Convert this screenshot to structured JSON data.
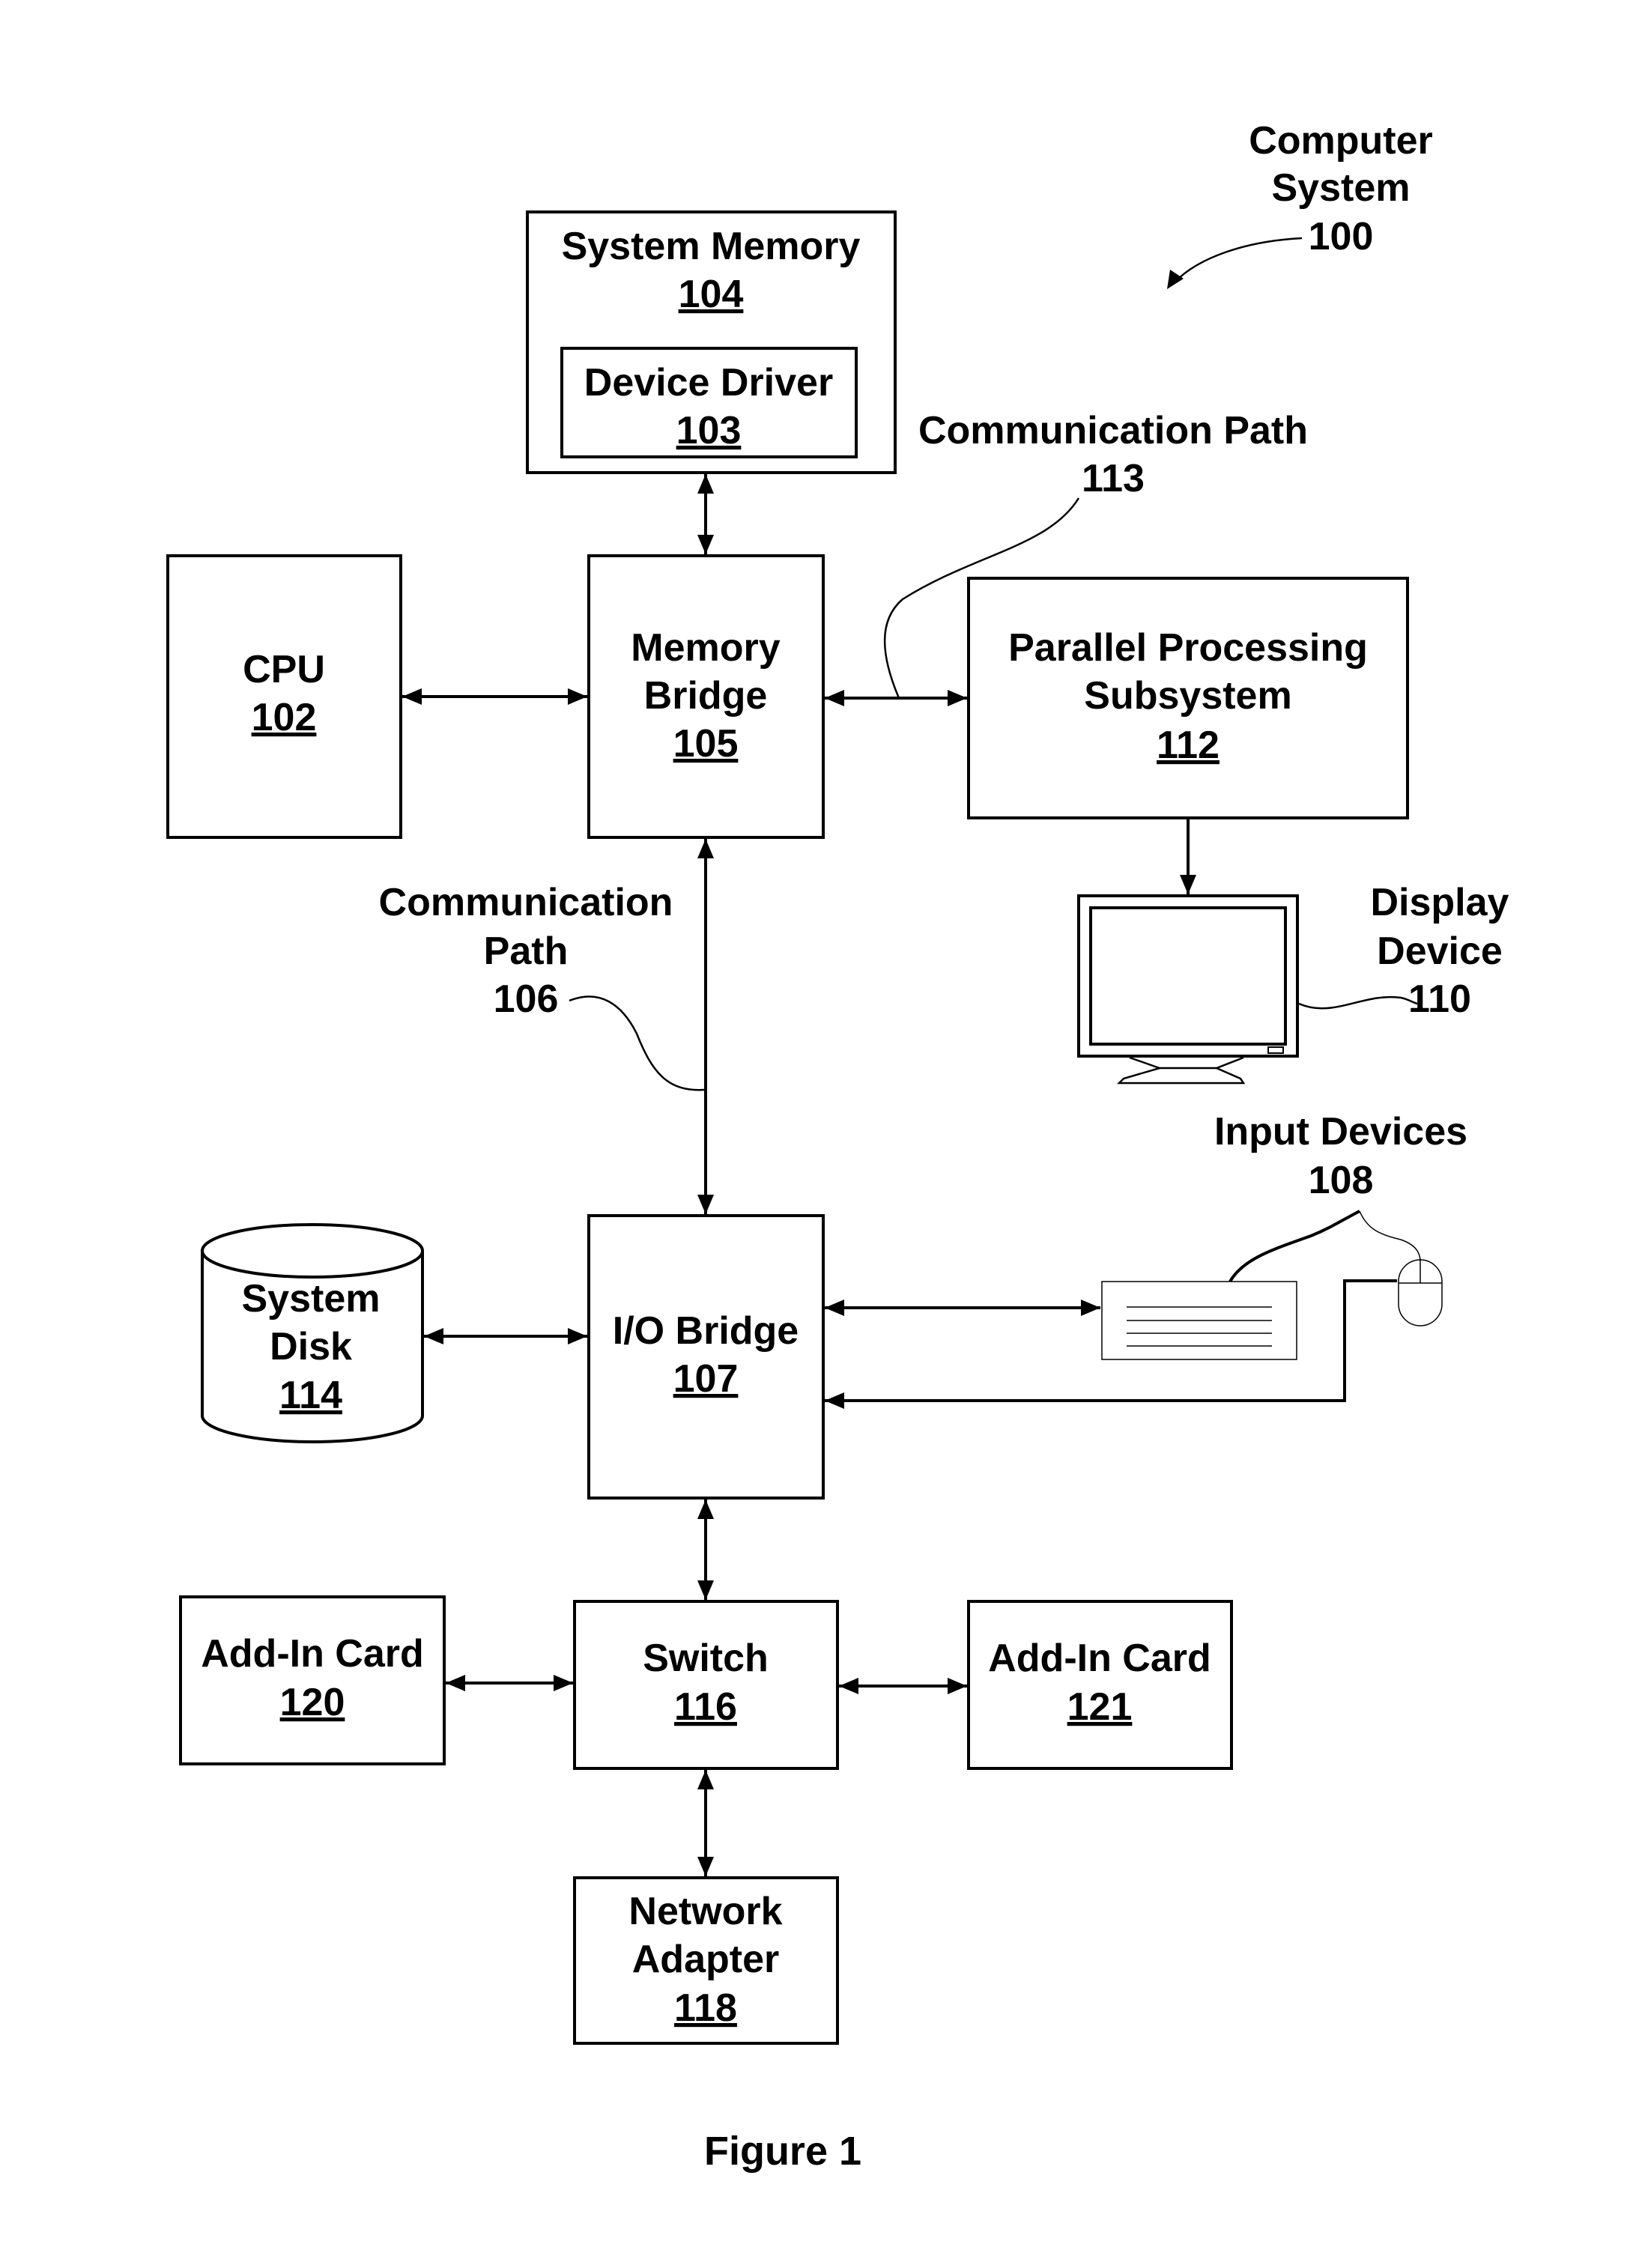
{
  "title": {
    "line1": "Computer",
    "line2": "System",
    "number": "100"
  },
  "caption": "Figure 1",
  "components": {
    "system_memory": {
      "label": "System Memory",
      "number": "104"
    },
    "device_driver": {
      "label": "Device Driver",
      "number": "103"
    },
    "cpu": {
      "label": "CPU",
      "number": "102"
    },
    "memory_bridge": {
      "line1": "Memory",
      "line2": "Bridge",
      "number": "105"
    },
    "parallel_processing": {
      "line1": "Parallel Processing",
      "line2": "Subsystem",
      "number": "112"
    },
    "display_device": {
      "line1": "Display",
      "line2": "Device",
      "number": "110"
    },
    "input_devices": {
      "label": "Input Devices",
      "number": "108"
    },
    "io_bridge": {
      "label": "I/O Bridge",
      "number": "107"
    },
    "system_disk": {
      "line1": "System",
      "line2": "Disk",
      "number": "114"
    },
    "add_in_card_120": {
      "label": "Add-In Card",
      "number": "120"
    },
    "switch": {
      "label": "Switch",
      "number": "116"
    },
    "add_in_card_121": {
      "label": "Add-In Card",
      "number": "121"
    },
    "network_adapter": {
      "line1": "Network",
      "line2": "Adapter",
      "number": "118"
    }
  },
  "paths": {
    "path_113": {
      "label": "Communication Path",
      "number": "113"
    },
    "path_106": {
      "line1": "Communication",
      "line2": "Path",
      "number": "106"
    }
  }
}
